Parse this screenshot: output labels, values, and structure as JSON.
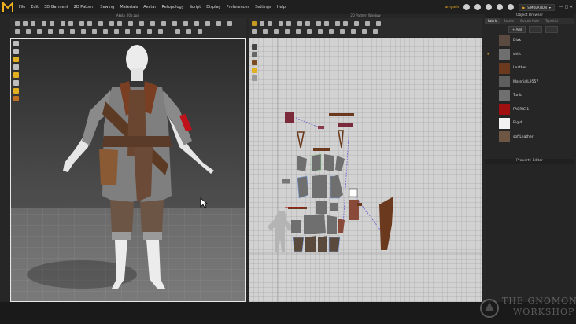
{
  "menu": {
    "items": [
      "File",
      "Edit",
      "3D Garment",
      "2D Pattern",
      "Sewing",
      "Materials",
      "Avatar",
      "Retopology",
      "Script",
      "Display",
      "Preferences",
      "Settings",
      "Help"
    ],
    "user": "amyash",
    "mode": "SIMULATION"
  },
  "panel3d": {
    "title": "Akola_00b.zprj"
  },
  "panel2d": {
    "title": "2D Pattern Window"
  },
  "object_browser": {
    "title": "Object Browser",
    "tabs": [
      "Fabric",
      "Button",
      "Button Hole",
      "Topstitch"
    ],
    "add_label": "+ Add",
    "fabrics": [
      {
        "name": "Dlak",
        "color": "#5a4a40",
        "checked": false
      },
      {
        "name": "shirt",
        "color": "#6f6f6f",
        "checked": true
      },
      {
        "name": "Leather",
        "color": "#6b3a1e",
        "checked": false
      },
      {
        "name": "MaterialL9557",
        "color": "#5e5e5e",
        "checked": false
      },
      {
        "name": "Tunic",
        "color": "#707070",
        "checked": false
      },
      {
        "name": "FABRIC 1",
        "color": "#a01010",
        "checked": false
      },
      {
        "name": "Rigid",
        "color": "#f2f2f2",
        "checked": false
      },
      {
        "name": "softLeather",
        "color": "#6d5744",
        "checked": false
      }
    ]
  },
  "property_editor": {
    "title": "Property Editor"
  },
  "watermark": {
    "line1": "THE GNOMON",
    "line2": "WORKSHOP"
  }
}
